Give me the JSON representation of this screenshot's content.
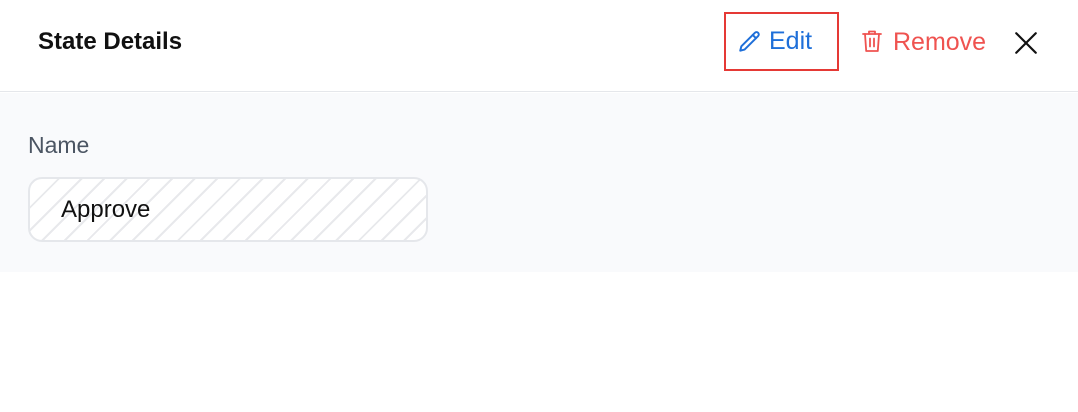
{
  "panel": {
    "title": "State Details"
  },
  "actions": {
    "edit_label": "Edit",
    "edit_icon": "pencil-icon",
    "remove_label": "Remove",
    "remove_icon": "trash-icon",
    "close_icon": "close-icon"
  },
  "form": {
    "name_label": "Name",
    "name_value": "Approve"
  },
  "colors": {
    "edit_accent": "#1e6fd9",
    "remove_accent": "#ef5350",
    "highlight_border": "#e53935",
    "section_background": "#f9fafc"
  }
}
